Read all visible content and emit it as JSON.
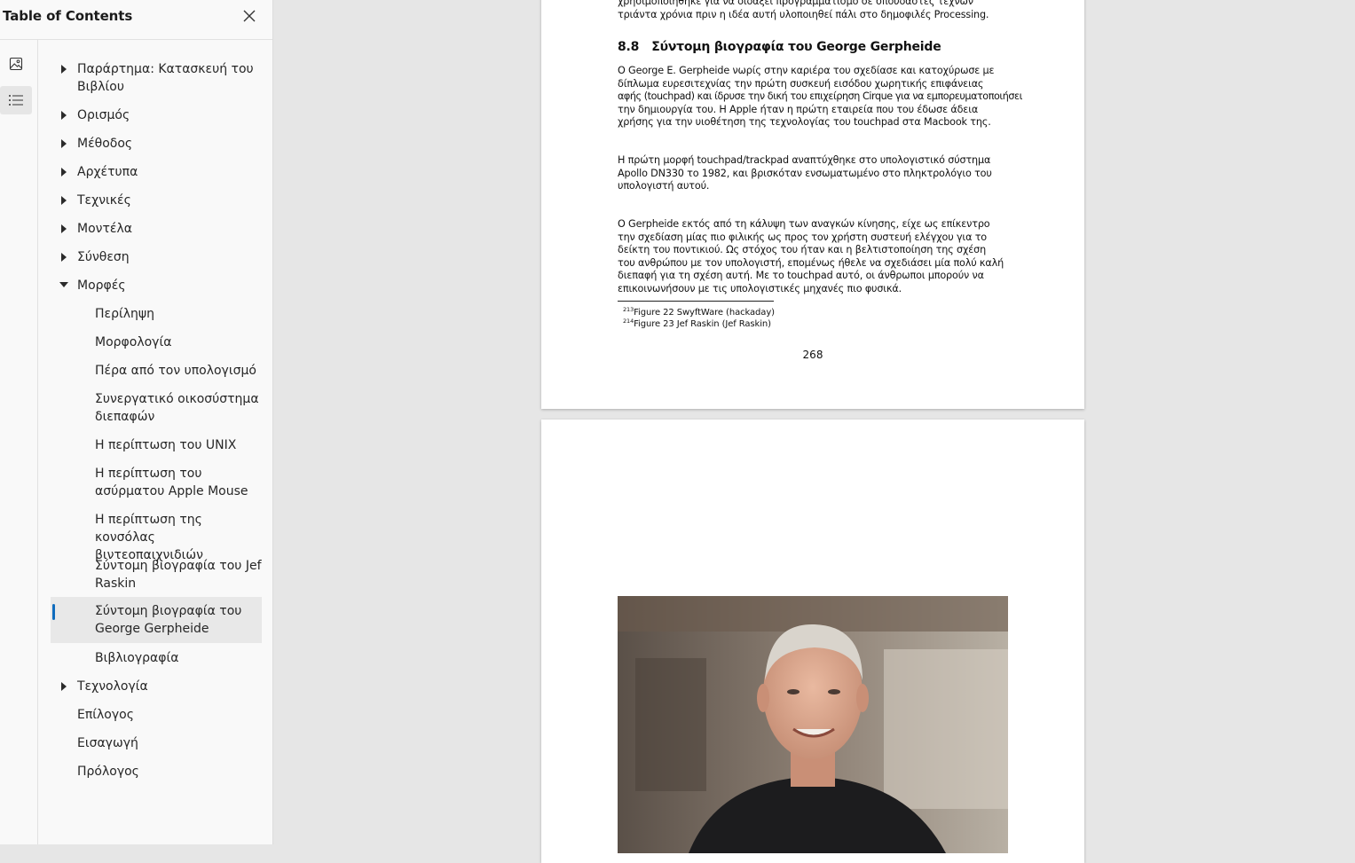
{
  "sidebar": {
    "title": "Table of Contents",
    "close_icon": "close-icon",
    "rail": [
      {
        "icon": "image-icon"
      },
      {
        "icon": "list-icon",
        "active": true
      }
    ],
    "items": [
      {
        "label": "Παράρτημα: Κατασκευή του Βιβλίου",
        "level": 1,
        "caret": "right"
      },
      {
        "label": "Ορισμός",
        "level": 1,
        "caret": "right"
      },
      {
        "label": "Μέθοδος",
        "level": 1,
        "caret": "right"
      },
      {
        "label": "Αρχέτυπα",
        "level": 1,
        "caret": "right"
      },
      {
        "label": "Τεχνικές",
        "level": 1,
        "caret": "right"
      },
      {
        "label": "Μοντέλα",
        "level": 1,
        "caret": "right"
      },
      {
        "label": "Σύνθεση",
        "level": 1,
        "caret": "right"
      },
      {
        "label": "Μορφές",
        "level": 1,
        "caret": "down"
      },
      {
        "label": "Περίληψη",
        "level": 2
      },
      {
        "label": "Μορφολογία",
        "level": 2
      },
      {
        "label": "Πέρα από τον υπολογισμό",
        "level": 2
      },
      {
        "label": "Συνεργατικό οικοσύστημα διεπαφών",
        "level": 2
      },
      {
        "label": "Η περίπτωση του UNIX",
        "level": 2
      },
      {
        "label": "Η περίπτωση του ασύρματου Apple Mouse",
        "level": 2
      },
      {
        "label": "Η περίπτωση της κονσόλας βιντεοπαιχνιδιών",
        "level": 2
      },
      {
        "label": "Σύντομη βιογραφία του Jef Raskin",
        "level": 2
      },
      {
        "label": "Σύντομη βιογραφία του George Gerpheide",
        "level": 2,
        "selected": true
      },
      {
        "label": "Βιβλιογραφία",
        "level": 2
      },
      {
        "label": "Τεχνολογία",
        "level": 1,
        "caret": "right"
      },
      {
        "label": "Επίλογος",
        "level": 1
      },
      {
        "label": "Εισαγωγή",
        "level": 1
      },
      {
        "label": "Πρόλογος",
        "level": 1
      }
    ]
  },
  "document": {
    "top_lines": [
      "χρησιμοποιήθηκε για να διδάξει προγραμματισμό σε σπουδαστές τεχνών",
      "τριάντα χρόνια πριν η ιδέα αυτή υλοποιηθεί πάλι στο δημοφιλές Processing."
    ],
    "section_number": "8.8",
    "section_title": "Σύντομη βιογραφία του George Gerpheide",
    "para1": [
      "Ο George E. Gerpheide νωρίς στην καριέρα του σχεδίασε και κατοχύρωσε με",
      "δίπλωμα ευρεσιτεχνίας την πρώτη συσκευή εισόδου χωρητικής επιφάνειας",
      "αφής (touchpad) και ίδρυσε την δική του επιχείρηση Cirque για να εμπορευματοποιήσει",
      "την δημιουργία του.  Η Apple ήταν η πρώτη εταιρεία που του έδωσε άδεια",
      "χρήσης για την υιοθέτηση της τεχνολογίας του touchpad στα Macbook της."
    ],
    "para2": [
      "Η πρώτη μορφή touchpad/trackpad αναπτύχθηκε στο υπολογιστικό σύστημα",
      "Apollo DN330 το 1982, και βρισκόταν ενσωματωμένο στο πληκτρολόγιο του",
      "υπολογιστή αυτού."
    ],
    "para3": [
      "Ο Gerpheide εκτός από τη κάλυψη των αναγκών κίνησης, είχε ως επίκεντρο",
      "την σχεδίαση μίας πιο φιλικής ως προς τον χρήστη συστευή ελέγχου για το",
      "δείκτη του ποντικιού.  Ως στόχος του ήταν και η βελτιστοποίηση της σχέση",
      "του ανθρώπου με τον υπολογιστή, επομένως ήθελε να σχεδιάσει μία πολύ καλή",
      "διεπαφή για τη σχέση αυτή.  Με το touchpad αυτό, οι άνθρωποι μπορούν να",
      "επικοινωνήσουν με τις υπολογιστικές μηχανές πιο φυσικά."
    ],
    "footnotes": [
      {
        "mark": "213",
        "text": "Figure 22 SwyftWare (hackaday)"
      },
      {
        "mark": "214",
        "text": "Figure 23 Jef Raskin (Jef Raskin)"
      }
    ],
    "page_number": "268"
  }
}
